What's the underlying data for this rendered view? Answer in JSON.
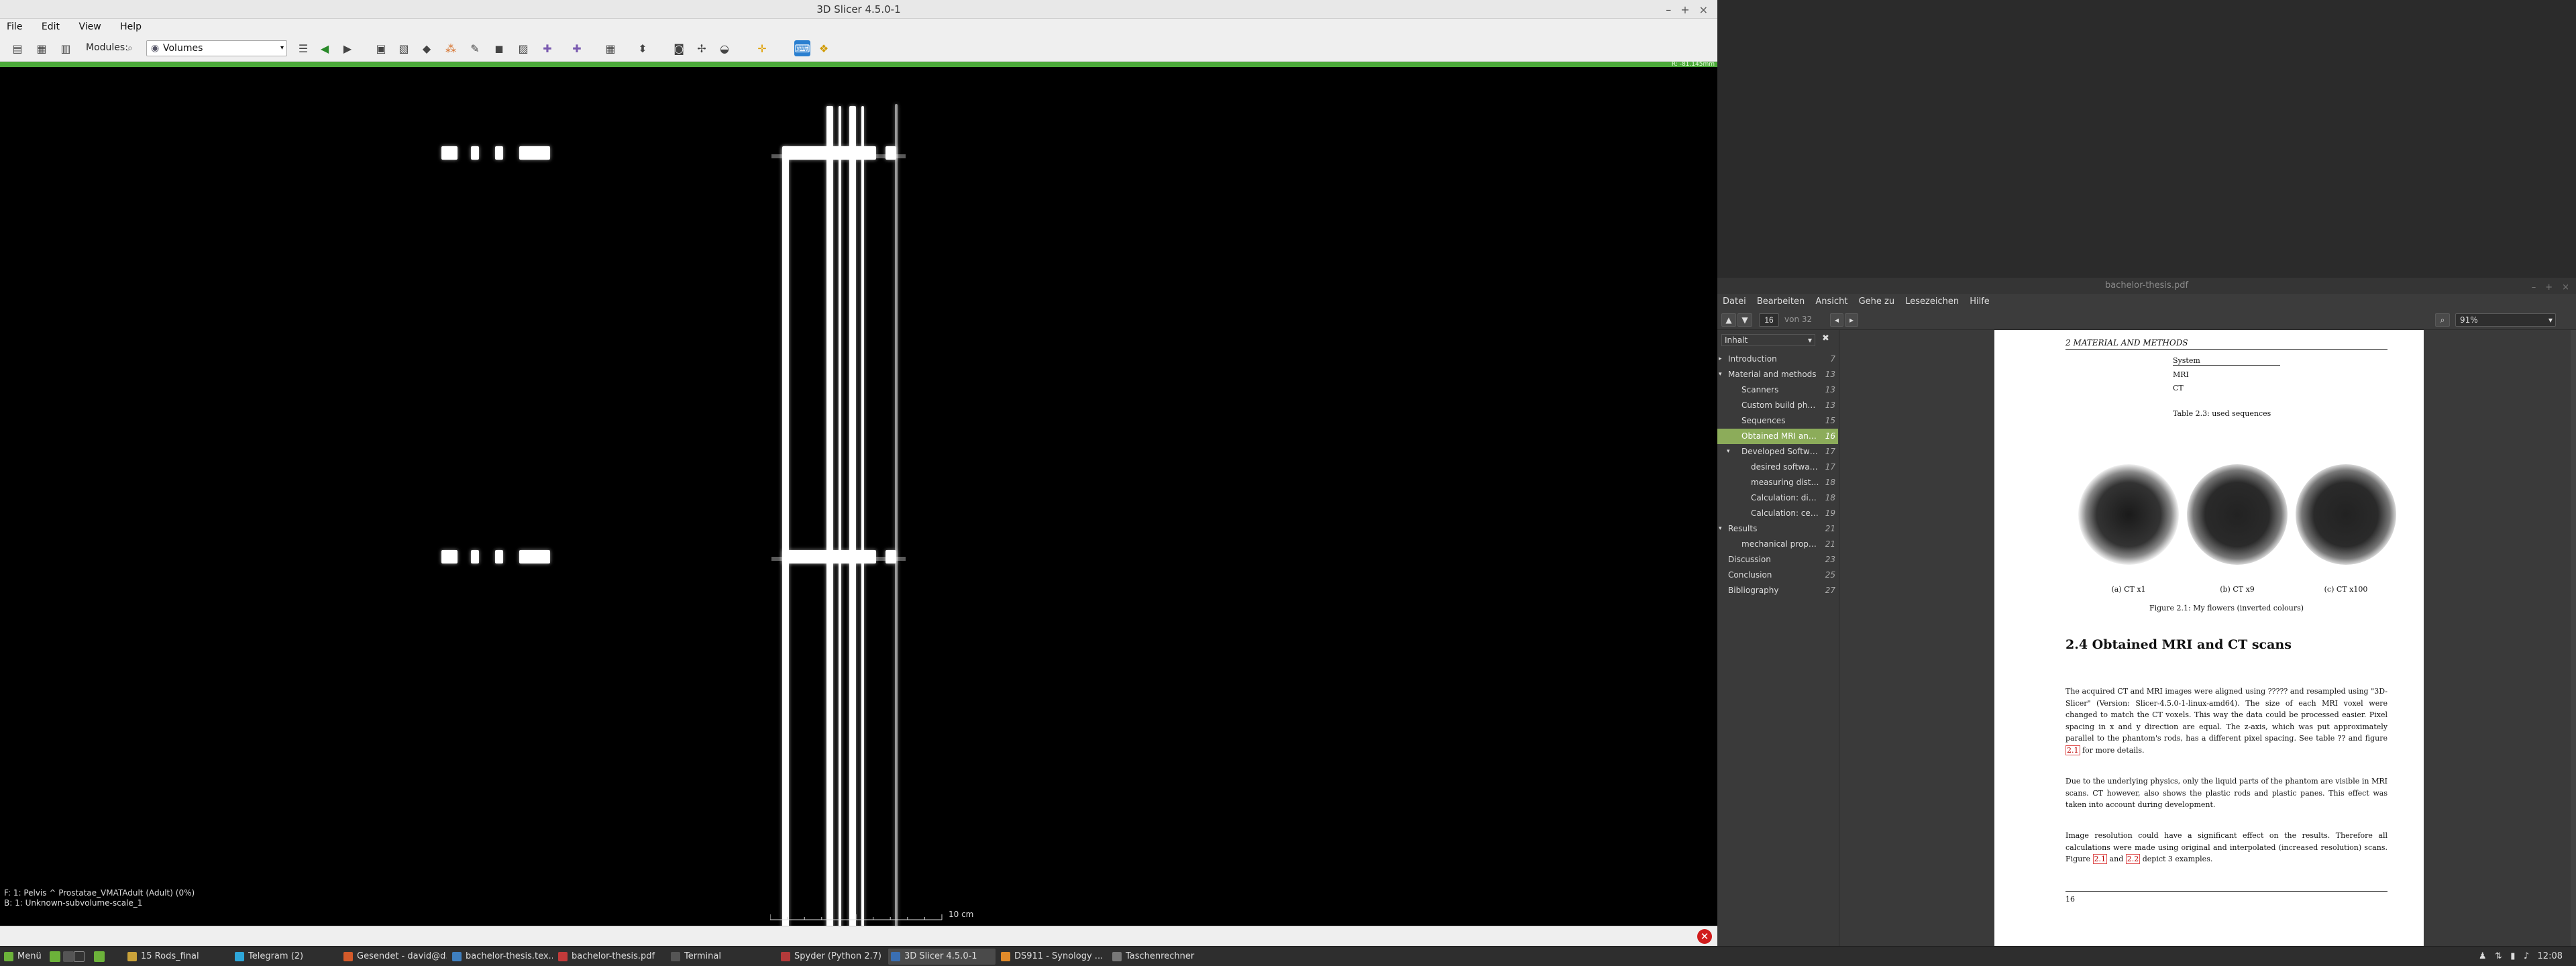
{
  "slicer": {
    "title": "3D Slicer 4.5.0-1",
    "menu": [
      "File",
      "Edit",
      "View",
      "Help"
    ],
    "modules_label": "Modules:",
    "modules_value": "Volumes",
    "status_right": "R: -81.145mm",
    "corner_text": "F: 1: Pelvis ^ Prostatae_VMATAdult (Adult) (0%)\nB: 1: Unknown-subvolume-scale_1",
    "scale_label": "10 cm",
    "window_controls": [
      "–",
      "+",
      "×"
    ]
  },
  "pdf": {
    "title": "bachelor-thesis.pdf",
    "menu": [
      "Datei",
      "Bearbeiten",
      "Ansicht",
      "Gehe zu",
      "Lesezeichen",
      "Hilfe"
    ],
    "page_current": "16",
    "page_total": "von 32",
    "zoom": "91%",
    "toc_label": "Inhalt",
    "toc": [
      {
        "label": "Introduction",
        "page": "7"
      },
      {
        "label": "Material and methods",
        "page": "13"
      },
      {
        "label": "Scanners",
        "page": "13"
      },
      {
        "label": "Custom build phant...",
        "page": "13"
      },
      {
        "label": "Sequences",
        "page": "15"
      },
      {
        "label": "Obtained MRI and C...",
        "page": "16"
      },
      {
        "label": "Developed Softwar...",
        "page": "17"
      },
      {
        "label": "desired software ...",
        "page": "17"
      },
      {
        "label": "measuring distort...",
        "page": "18"
      },
      {
        "label": "Calculation: dice ...",
        "page": "18"
      },
      {
        "label": "Calculation: cente...",
        "page": "19"
      },
      {
        "label": "Results",
        "page": "21"
      },
      {
        "label": "mechanical properti...",
        "page": "21"
      },
      {
        "label": "Discussion",
        "page": "23"
      },
      {
        "label": "Conclusion",
        "page": "25"
      },
      {
        "label": "Bibliography",
        "page": "27"
      }
    ],
    "doc": {
      "running_header": "2  MATERIAL AND METHODS",
      "table_header": "System",
      "table_rows": [
        "MRI",
        "CT"
      ],
      "table_caption": "Table 2.3: used sequences",
      "sub_captions": [
        "(a) CT x1",
        "(b) CT x9",
        "(c) CT x100"
      ],
      "figure_caption": "Figure 2.1: My flowers (inverted colours)",
      "section_heading": "2.4  Obtained MRI and CT scans",
      "para1": "The acquired CT and MRI images were aligned using ????? and resampled using \"3D-Slicer\" (Version: Slicer-4.5.0-1-linux-amd64). The size of each MRI voxel were changed to match the CT voxels. This way the data could be processed easier. Pixel spacing in x and y direction are equal. The z-axis, which was put approximately parallel to the phantom's rods, has a different pixel spacing. See table ?? and figure",
      "para1_ref": "2.1",
      "para1_end": "for more details.",
      "para2": "Due to the underlying physics, only the liquid parts of the phantom are visible in MRI scans. CT however, also shows the plastic rods and plastic panes. This effect was taken into account during development.",
      "para3_start": "Image resolution could have a significant effect on the results. Therefore all calculations were made using original and interpolated (increased resolution) scans. Figure",
      "para3_ref1": "2.1",
      "para3_and": "and",
      "para3_ref2": "2.2",
      "para3_end": "depict 3 examples.",
      "page_number": "16"
    }
  },
  "taskbar": {
    "menu": "Menü",
    "tasks": [
      {
        "label": "15 Rods_final",
        "color": "#c9a23a"
      },
      {
        "label": "Telegram (2)",
        "color": "#2ea6d9"
      },
      {
        "label": "Gesendet - david@d...",
        "color": "#d35a2a"
      },
      {
        "label": "bachelor-thesis.tex...",
        "color": "#3f7fbf"
      },
      {
        "label": "bachelor-thesis.pdf",
        "color": "#c23a3a"
      },
      {
        "label": "Terminal",
        "color": "#555555"
      },
      {
        "label": "Spyder (Python 2.7)",
        "color": "#b33a3a"
      },
      {
        "label": "3D Slicer 4.5.0-1",
        "color": "#3a6fb3"
      },
      {
        "label": "DS911 - Synology ...",
        "color": "#e08a2a"
      },
      {
        "label": "Taschenrechner",
        "color": "#777777"
      }
    ],
    "clock": "12:08"
  }
}
